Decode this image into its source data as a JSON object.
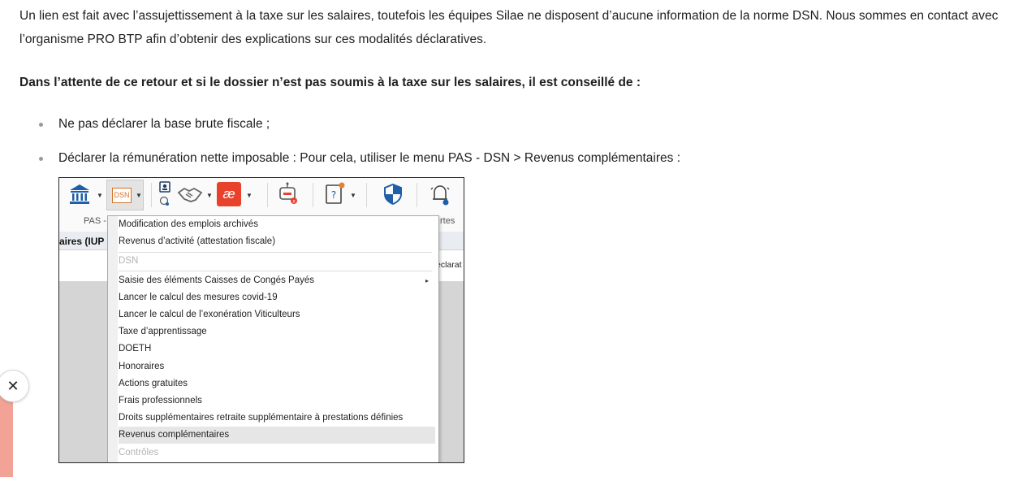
{
  "article": {
    "paragraph1": "Un lien est fait avec l’assujettissement à la taxe sur les salaires, toutefois les équipes Silae ne disposent d’aucune information de la norme DSN. Nous sommes en contact avec l’organisme PRO BTP afin d’obtenir des explications sur ces modalités déclaratives.",
    "paragraph2": "Dans l’attente de ce retour et si le dossier n’est pas soumis à la taxe sur les salaires, il est conseillé de :",
    "bullets": [
      "Ne pas déclarer la base brute fiscale ;",
      "Déclarer la rémunération nette imposable : Pour cela, utiliser le menu PAS - DSN > Revenus complémentaires :"
    ]
  },
  "screenshot": {
    "ribbon": {
      "left_label": "PAS -",
      "right_label": "rtes",
      "dsn_icon_text": "DSN",
      "app_badge_text": "æ"
    },
    "left_bar_text": "aires (IUP",
    "right_bar_text": "éclarat",
    "menu_items": [
      {
        "label": "Modification des emplois archivés",
        "state": "normal"
      },
      {
        "label": "Revenus d’activité (attestation fiscale)",
        "state": "normal"
      },
      {
        "label": "DSN",
        "state": "disabled"
      },
      {
        "label": "Saisie des éléments Caisses de Congés Payés",
        "state": "submenu"
      },
      {
        "label": "Lancer le calcul des mesures covid-19",
        "state": "normal"
      },
      {
        "label": "Lancer le calcul de l’exonération Viticulteurs",
        "state": "normal"
      },
      {
        "label": "Taxe d’apprentissage",
        "state": "normal"
      },
      {
        "label": "DOETH",
        "state": "normal"
      },
      {
        "label": "Honoraires",
        "state": "normal"
      },
      {
        "label": "Actions gratuites",
        "state": "normal"
      },
      {
        "label": "Frais professionnels",
        "state": "normal"
      },
      {
        "label": "Droits supplémentaires retraite supplémentaire à prestations définies",
        "state": "normal"
      },
      {
        "label": "Revenus complémentaires",
        "state": "highlighted"
      },
      {
        "label": "Contrôles",
        "state": "disabled"
      }
    ],
    "submenu_arrow": "▸",
    "icons": [
      "bank-icon",
      "dsn-icon",
      "person-card-icon",
      "handshake-icon",
      "app-badge-icon",
      "robot-icon",
      "help-book-icon",
      "shield-icon",
      "bell-settings-icon"
    ]
  },
  "close_icon": "✕",
  "colors": {
    "badge_red": "#e8412c",
    "shield_blue": "#1f5fa8",
    "highlight": "#e6e6e6",
    "pink_accent": "#f2a396"
  }
}
